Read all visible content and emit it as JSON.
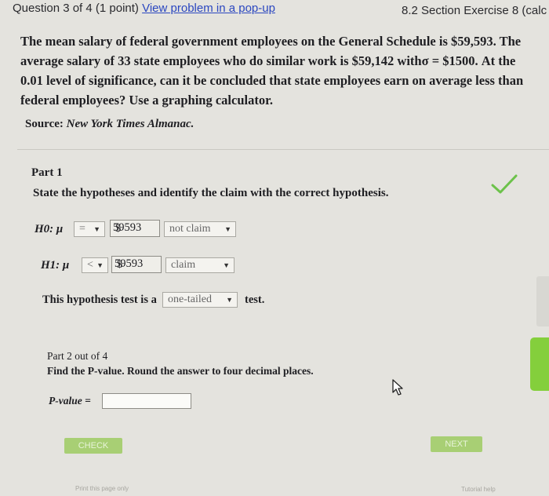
{
  "header": {
    "question_label": "Question 3 of 4 (1 point)",
    "popup_link": "View problem in a pop-up",
    "section_title": "8.2 Section Exercise 8 (calc"
  },
  "question": {
    "text": "The mean salary of federal government employees on the General Schedule is $59,593. The average salary of 33 state employees who do similar work is $59,142 withσ = $1500. At the 0.01 level of significance, can it be concluded that state employees earn on average less than federal employees? Use a graphing calculator.",
    "source_label": "Source:",
    "source_name": "New York Times Almanac."
  },
  "part1": {
    "title": "Part 1",
    "instruction": "State the hypotheses and identify the claim with the correct hypothesis.",
    "h0": {
      "label": "H0: μ",
      "operator": "=",
      "currency": "$",
      "value": "59593",
      "claim": "not claim"
    },
    "h1": {
      "label": "H1: μ",
      "operator": "<",
      "currency": "$",
      "value": "59593",
      "claim": "claim"
    },
    "test_prefix": "This hypothesis test is a",
    "test_type": "one-tailed",
    "test_suffix": "test."
  },
  "part2": {
    "title": "Part 2 out of 4",
    "instruction": "Find the P-value. Round the answer to four decimal places.",
    "pvalue_label": "P-value =",
    "pvalue_value": ""
  },
  "buttons": {
    "check": "CHECK",
    "next": "NEXT"
  },
  "footer": {
    "print": "Print this page only",
    "tutorial": "Tutorial help"
  },
  "colors": {
    "link": "#2b47c0",
    "check_mark": "#6cc24a",
    "button": "#a8cf74",
    "green_tab": "#84cf3c"
  }
}
